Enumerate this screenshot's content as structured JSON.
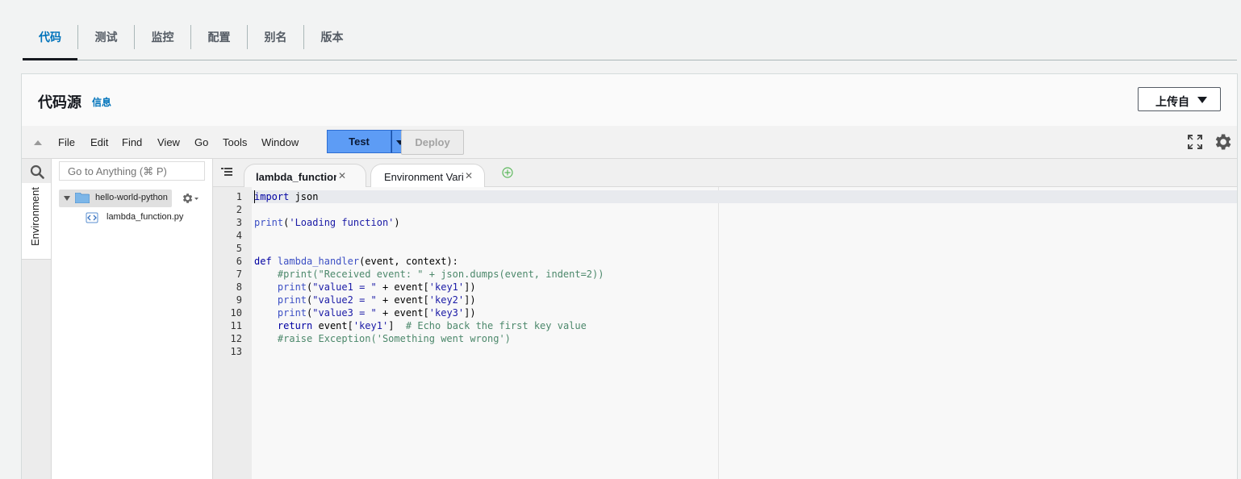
{
  "tabs": [
    {
      "label": "代码",
      "active": true
    },
    {
      "label": "测试",
      "active": false
    },
    {
      "label": "监控",
      "active": false
    },
    {
      "label": "配置",
      "active": false
    },
    {
      "label": "别名",
      "active": false
    },
    {
      "label": "版本",
      "active": false
    }
  ],
  "panel": {
    "title": "代码源",
    "info_link": "信息",
    "upload_button": "上传自"
  },
  "menubar": {
    "items": [
      "File",
      "Edit",
      "Find",
      "View",
      "Go",
      "Tools",
      "Window"
    ],
    "test_button": "Test",
    "deploy_button": "Deploy"
  },
  "sidebar": {
    "environment_tab": "Environment",
    "goto_placeholder": "Go to Anything (⌘ P)",
    "root_folder": "hello-world-python",
    "files": [
      "lambda_function.py"
    ]
  },
  "editor": {
    "tabs": [
      {
        "label": "lambda_function",
        "active": true
      },
      {
        "label": "Environment Vari",
        "active": false
      }
    ],
    "line_numbers": [
      "1",
      "2",
      "3",
      "4",
      "5",
      "6",
      "7",
      "8",
      "9",
      "10",
      "11",
      "12",
      "13"
    ],
    "code_lines": [
      "import json",
      "",
      "print('Loading function')",
      "",
      "",
      "def lambda_handler(event, context):",
      "    #print(\"Received event: \" + json.dumps(event, indent=2))",
      "    print(\"value1 = \" + event['key1'])",
      "    print(\"value2 = \" + event['key2'])",
      "    print(\"value3 = \" + event['key3'])",
      "    return event['key1']  # Echo back the first key value",
      "    #raise Exception('Something went wrong')",
      ""
    ]
  },
  "colors": {
    "accent": "#0073bb",
    "test_button": "#5d9cf5",
    "keyword": "#0000a2",
    "comment": "#4c886b"
  },
  "icons": [
    "search-icon",
    "folder-icon",
    "gear-icon",
    "python-file-icon",
    "fullscreen-icon",
    "settings-gear-icon",
    "close-icon",
    "add-tab-icon",
    "tabs-menu-icon"
  ]
}
